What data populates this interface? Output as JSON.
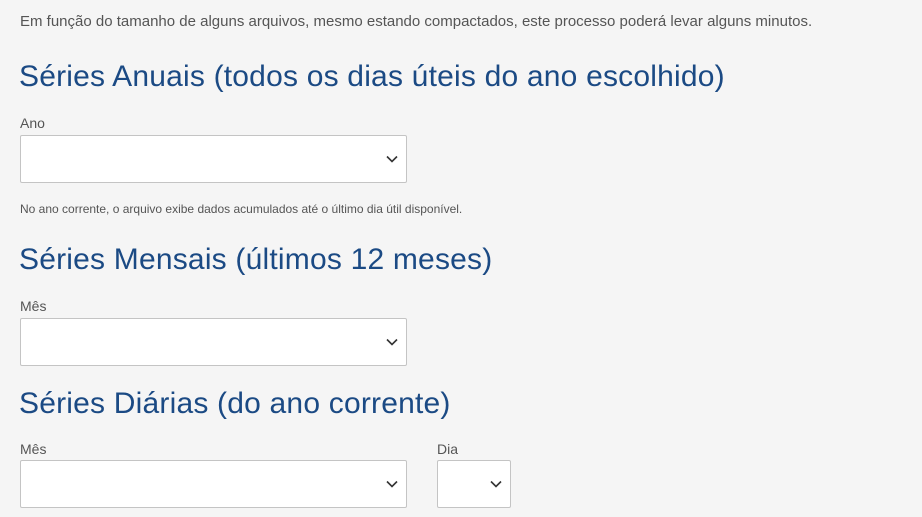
{
  "intro_text": "Em função do tamanho de alguns arquivos, mesmo estando compactados, este processo poderá levar alguns minutos.",
  "annual": {
    "title": "Séries Anuais (todos os dias úteis do ano escolhido)",
    "year_label": "Ano",
    "year_value": "",
    "note": "No ano corrente, o arquivo exibe dados acumulados até o último dia útil disponível."
  },
  "monthly": {
    "title": "Séries Mensais (últimos 12 meses)",
    "month_label": "Mês",
    "month_value": ""
  },
  "daily": {
    "title": "Séries Diárias (do ano corrente)",
    "month_label": "Mês",
    "month_value": "",
    "day_label": "Dia",
    "day_value": ""
  },
  "icons": {
    "dropdown": "chevron-down-icon"
  },
  "colors": {
    "heading": "#1b4a84",
    "text": "#555555",
    "background": "#f5f5f5",
    "select_border": "#c4c4c4"
  }
}
